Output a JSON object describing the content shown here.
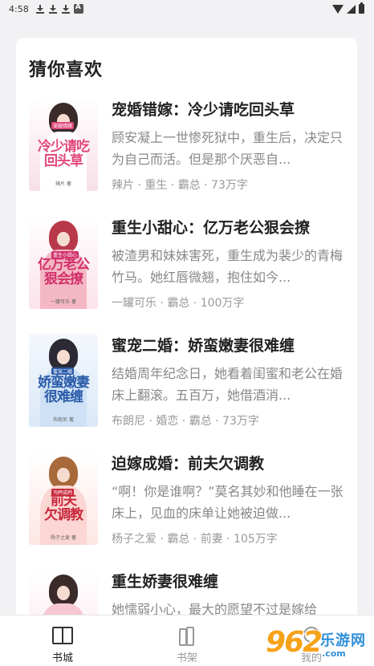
{
  "status_bar": {
    "time": "4:58"
  },
  "section": {
    "title": "猜你喜欢"
  },
  "books": [
    {
      "title": "宠婚错嫁：冷少请吃回头草",
      "desc": "顾安凝上一世惨死狱中，重生后，决定只为自己而活。但是那个厌恶自...",
      "meta": "辣片 · 重生 · 霸总 · 73万字",
      "cover_title": "冷少请吃回头草",
      "cover_color": "#f8dfe8",
      "cover_accent": "#e0467a"
    },
    {
      "title": "重生小甜心：亿万老公狠会撩",
      "desc": "被渣男和妹妹害死，重生成为裴少的青梅竹马。她红唇微翘，抱住如今...",
      "meta": "一罐可乐 · 霸总 · 100万字",
      "cover_title": "亿万老公狠会撩",
      "cover_color": "#fbe3ea",
      "cover_accent": "#d2306a"
    },
    {
      "title": "蜜宠二婚：娇蛮嫩妻很难缠",
      "desc": "结婚周年纪念日，她看着闺蜜和老公在婚床上翻滚。五百万，她借酒消...",
      "meta": "布朗尼 · 婚恋 · 霸总 · 73万字",
      "cover_title": "娇蛮嫩妻很难缠",
      "cover_color": "#e6f0fa",
      "cover_accent": "#2a5aa8"
    },
    {
      "title": "迫嫁成婚：前夫欠调教",
      "desc": "“啊！你是谁啊？”莫名其妙和他睡在一张床上，见血的床单让她被迫做...",
      "meta": "杨子之爱 · 霸总 · 前妻 · 105万字",
      "cover_title": "前夫欠调教",
      "cover_color": "#fde6e4",
      "cover_accent": "#c8283c"
    },
    {
      "title": "重生娇妻很难缠",
      "desc": "她懦弱小心，最大的愿望不过是嫁给",
      "meta": "",
      "cover_title": "",
      "cover_color": "#fae6ec",
      "cover_accent": "#d04878"
    }
  ],
  "tabs": [
    {
      "label": "书城",
      "icon": "book-icon",
      "color": "#222"
    },
    {
      "label": "书架",
      "icon": "bookshelf-icon",
      "color": "#999"
    },
    {
      "label": "我的",
      "icon": "user-icon",
      "color": "#999"
    }
  ],
  "watermark": {
    "number": "962",
    "text": "乐游网",
    "sub": ".com"
  }
}
